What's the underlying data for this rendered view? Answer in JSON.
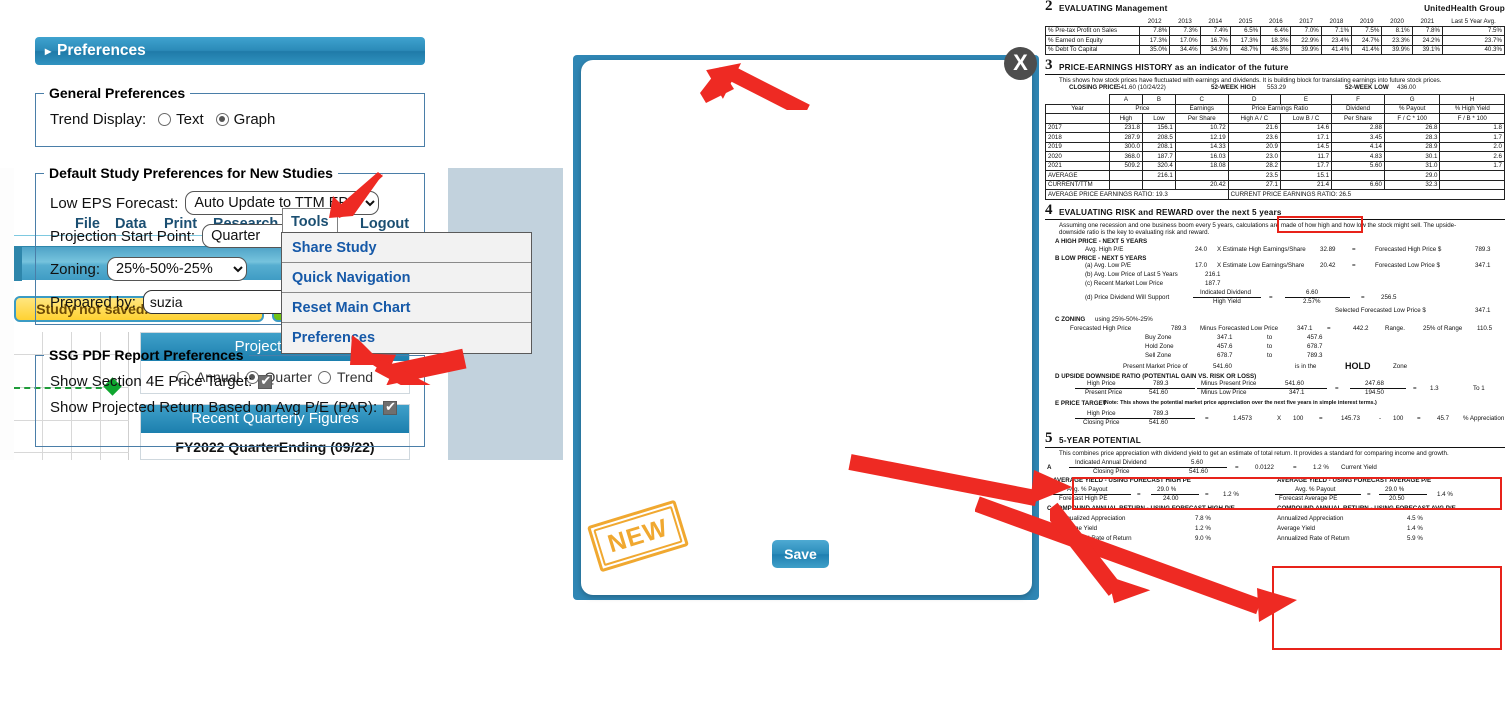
{
  "app": {
    "menu": [
      {
        "label": "File",
        "name": "menu-file"
      },
      {
        "label": "Data",
        "name": "menu-data"
      },
      {
        "label": "Print",
        "name": "menu-print"
      },
      {
        "label": "Research",
        "name": "menu-research"
      },
      {
        "label": "Tools",
        "name": "menu-tools"
      },
      {
        "label": "Logout",
        "name": "menu-logout"
      }
    ],
    "tools_dropdown": [
      "Share Study",
      "Quick Navigation",
      "Reset Main Chart",
      "Preferences"
    ],
    "not_saved_button": "Study not saved. Click to save.",
    "green_button": "G",
    "projection_panel": {
      "title": "Projection S",
      "options": [
        "Annual",
        "Quarter",
        "Trend"
      ],
      "selected": "Quarter"
    },
    "recent_panel": {
      "title": "Recent Quarterly Figures",
      "line": "FY2022 QuarterEnding (09/22)"
    }
  },
  "dialog": {
    "close_label": "X",
    "header": "Preferences",
    "header_marker": "▸",
    "general": {
      "legend": "General Preferences",
      "trend_label": "Trend Display:",
      "options": [
        "Text",
        "Graph"
      ],
      "selected": "Graph"
    },
    "defaults": {
      "legend": "Default Study Preferences for New Studies",
      "low_eps_label": "Low EPS Forecast:",
      "low_eps_value": "Auto Update to TTM EPS",
      "proj_start_label": "Projection Start Point:",
      "proj_start_value": "Quarter",
      "zoning_label": "Zoning:",
      "zoning_value": "25%-50%-25%",
      "prepared_label": "Prepared by:",
      "prepared_value": "suzia",
      "prepared_placeholder": "Prepared by"
    },
    "ssg": {
      "legend": "SSG PDF Report Preferences",
      "price_target_label": "Show Section 4E Price Target:",
      "price_target_checked": true,
      "par_label": "Show Projected Return Based on Avg P/E (PAR):",
      "par_checked": true
    },
    "save_label": "Save",
    "new_stamp": "NEW"
  },
  "report": {
    "company": "UnitedHealth Group",
    "sec2": {
      "num": "2",
      "title": "EVALUATING Management",
      "years": [
        "2012",
        "2013",
        "2014",
        "2015",
        "2016",
        "2017",
        "2018",
        "2019",
        "2020",
        "2021"
      ],
      "avg_header": "Last 5 Year Avg.",
      "rows": [
        {
          "label": "% Pre-tax Profit on Sales",
          "values": [
            "7.8%",
            "7.3%",
            "7.4%",
            "6.5%",
            "6.4%",
            "7.0%",
            "7.1%",
            "7.5%",
            "8.1%",
            "7.8%"
          ],
          "avg": "7.5%"
        },
        {
          "label": "% Earned on Equity",
          "values": [
            "17.3%",
            "17.0%",
            "16.7%",
            "17.3%",
            "18.3%",
            "22.9%",
            "23.4%",
            "24.7%",
            "23.3%",
            "24.2%"
          ],
          "avg": "23.7%"
        },
        {
          "label": "% Debt To Capital",
          "values": [
            "35.0%",
            "34.4%",
            "34.9%",
            "48.7%",
            "46.3%",
            "39.9%",
            "41.4%",
            "41.4%",
            "39.9%",
            "39.1%"
          ],
          "avg": "40.3%"
        }
      ]
    },
    "sec3": {
      "num": "3",
      "title": "PRICE-EARNINGS HISTORY as an indicator of the future",
      "note": "This shows how stock prices have fluctuated with earnings and dividends.  It is building block for translating earnings into future stock prices.",
      "closing_price_label": "CLOSING PRICE",
      "closing_price_value": "541.60 (10/24/22)",
      "wk_high_label": "52-WEEK HIGH",
      "wk_high_value": "553.29",
      "wk_low_label": "52-WEEK LOW",
      "wk_low_value": "436.00",
      "col_letters": [
        "A",
        "B",
        "C",
        "D",
        "E",
        "F",
        "G",
        "H"
      ],
      "group_headers": [
        "Year",
        "Price",
        "Earnings",
        "Price Earnings Ratio",
        "Dividend",
        "% Payout",
        "% High Yield"
      ],
      "sub_headers": [
        "High",
        "Low",
        "Per Share",
        "High A / C",
        "Low B / C",
        "Per Share",
        "F / C * 100",
        "F / B * 100"
      ],
      "rows": [
        {
          "year": "2017",
          "high": "231.8",
          "low": "156.1",
          "eps": "10.72",
          "pe_high": "21.6",
          "pe_low": "14.6",
          "div": "2.88",
          "payout": "26.8",
          "yield": "1.8"
        },
        {
          "year": "2018",
          "high": "287.9",
          "low": "208.5",
          "eps": "12.19",
          "pe_high": "23.6",
          "pe_low": "17.1",
          "div": "3.45",
          "payout": "28.3",
          "yield": "1.7"
        },
        {
          "year": "2019",
          "high": "300.0",
          "low": "208.1",
          "eps": "14.33",
          "pe_high": "20.9",
          "pe_low": "14.5",
          "div": "4.14",
          "payout": "28.9",
          "yield": "2.0"
        },
        {
          "year": "2020",
          "high": "368.0",
          "low": "187.7",
          "eps": "16.03",
          "pe_high": "23.0",
          "pe_low": "11.7",
          "div": "4.83",
          "payout": "30.1",
          "yield": "2.6"
        },
        {
          "year": "2021",
          "high": "509.2",
          "low": "320.4",
          "eps": "18.08",
          "pe_high": "28.2",
          "pe_low": "17.7",
          "div": "5.60",
          "payout": "31.0",
          "yield": "1.7"
        },
        {
          "year": "AVERAGE",
          "high": "",
          "low": "216.1",
          "eps": "",
          "pe_high": "23.5",
          "pe_low": "15.1",
          "div": "",
          "payout": "29.0",
          "yield": ""
        },
        {
          "year": "CURRENT/TTM",
          "high": "",
          "low": "",
          "eps": "20.42",
          "pe_high": "27.1",
          "pe_low": "21.4",
          "div": "6.60",
          "payout": "32.3",
          "yield": ""
        }
      ],
      "avg_pe_ratio": "AVERAGE PRICE EARNINGS RATIO: 19.3",
      "current_pe_ratio": "CURRENT PRICE EARNINGS RATIO: 26.5"
    },
    "sec4": {
      "num": "4",
      "title": "EVALUATING RISK and REWARD over the next 5 years",
      "note": "Assuming one recession and one business boom every 5 years, calculations are made of how high and how low the stock might sell.  The upside-downside ratio is the key to evaluating risk and reward.",
      "a_title": "A HIGH PRICE - NEXT 5 YEARS",
      "a_label": "Avg. High P/E",
      "a_pe": "24.0",
      "a_mid": "X Estimate High Earnings/Share",
      "a_eps": "32.89",
      "a_eq": "=",
      "a_result_label": "Forecasted High Price $",
      "a_result": "789.3",
      "b_title": "B LOW PRICE - NEXT 5 YEARS",
      "b_a_label": "(a) Avg. Low P/E",
      "b_a_pe": "17.0",
      "b_a_mid": "X Estimate Low Earnings/Share",
      "b_a_eps": "20.42",
      "b_a_result_label": "Forecasted Low Price $",
      "b_a_result": "347.1",
      "b_b_label": "(b) Avg. Low Price of Last 5 Years",
      "b_b_value": "216.1",
      "b_c_label": "(c) Recent Market Low Price",
      "b_c_value": "187.7",
      "b_d_label": "(d) Price Dividend Will Support",
      "b_d_num_label": "Indicated Dividend",
      "b_d_den_label": "High Yield",
      "b_d_num": "6.60",
      "b_d_den": "2.57%",
      "b_d_result": "256.5",
      "selected_low_label": "Selected Forecasted Low Price $",
      "selected_low_value": "347.1",
      "c_title": "C ZONING",
      "c_using": "using 25%-50%-25%",
      "c_fhp_label": "Forecasted High Price",
      "c_fhp": "789.3",
      "c_minus_label": "Minus Forecasted Low Price",
      "c_flp": "347.1",
      "c_range": "442.2",
      "c_range_label": "Range.",
      "c_pct_label": "25% of Range",
      "c_pct_value": "110.5",
      "zones": [
        {
          "name": "Buy Zone",
          "from": "347.1",
          "to": "457.6"
        },
        {
          "name": "Hold Zone",
          "from": "457.6",
          "to": "678.7"
        },
        {
          "name": "Sell Zone",
          "from": "678.7",
          "to": "789.3"
        }
      ],
      "present_label": "Present Market Price of",
      "present_value": "541.60",
      "is_in_the": "is in the",
      "zone_result": "HOLD",
      "zone_word": "Zone",
      "d_title": "D UPSIDE DOWNSIDE RATIO (POTENTIAL GAIN VS. RISK OR LOSS)",
      "d_high_label": "High Price",
      "d_high": "789.3",
      "d_present_label": "Present Price",
      "d_present": "541.60",
      "d_minus_present_label": "Minus Present Price",
      "d_minus_present": "541.60",
      "d_minus_low_label": "Minus Low Price",
      "d_minus_low": "347.1",
      "d_num": "247.68",
      "d_den": "194.50",
      "d_ratio": "1.3",
      "d_to1": "To 1",
      "e_title": "E PRICE TARGET",
      "e_note": "(Note: This shows the potential market price appreciation over the next five years in simple interest terms.)",
      "e_high_label": "High Price",
      "e_high": "789.3",
      "e_close_label": "Closing Price",
      "e_close": "541.60",
      "e_quotient": "1.4573",
      "e_x": "X",
      "e_100": "100",
      "e_product": "145.73",
      "e_minus": "-",
      "e_minus_100": "100",
      "e_result": "45.7",
      "e_pct_label": "% Appreciation"
    },
    "sec5": {
      "num": "5",
      "title": "5-YEAR POTENTIAL",
      "note": "This combines price appreciation with dividend yield to get an estimate of total return.  It provides a standard for comparing income and growth.",
      "a_letter": "A",
      "a_num_label": "Indicated Annual Dividend",
      "a_num": "5.60",
      "a_den_label": "Closing Price",
      "a_den": "541.60",
      "a_quotient": "0.0122",
      "a_pct": "1.2 %",
      "a_pct_label": "Current Yield",
      "b_left_title": "B AVERAGE YIELD - USING FORECAST HIGH PE",
      "b_left_num_label": "Avg. % Payout",
      "b_left_num": "29.0 %",
      "b_left_den_label": "Forecast High PE",
      "b_left_den": "24.00",
      "b_left_result": "1.2 %",
      "b_right_title": "AVERAGE YIELD - USING FORECAST AVERAGE P/E",
      "b_right_num_label": "Avg. % Payout",
      "b_right_num": "29.0 %",
      "b_right_den_label": "Forecast Average PE",
      "b_right_den": "20.50",
      "b_right_result": "1.4 %",
      "c_left_title": "C COMPOUND ANNUAL RETURN - USING FORECAST HIGH P/E",
      "c_right_title": "COMPOUND ANNUAL RETURN - USING FORECAST AVG P/E",
      "c_left_rows": [
        {
          "label": "Annualized Appreciation",
          "value": "7.8 %"
        },
        {
          "label": "Average Yield",
          "value": "1.2 %"
        },
        {
          "label": "Annualized Rate of Return",
          "value": "9.0 %"
        }
      ],
      "c_right_rows": [
        {
          "label": "Annualized Appreciation",
          "value": "4.5 %"
        },
        {
          "label": "Average Yield",
          "value": "1.4 %"
        },
        {
          "label": "Annualized Rate of Return",
          "value": "5.9 %"
        }
      ]
    }
  },
  "annotations": {
    "accent_red": "#ee2a23",
    "accent_blue": "#2b8cba",
    "stamp_orange": "#f0a830"
  }
}
